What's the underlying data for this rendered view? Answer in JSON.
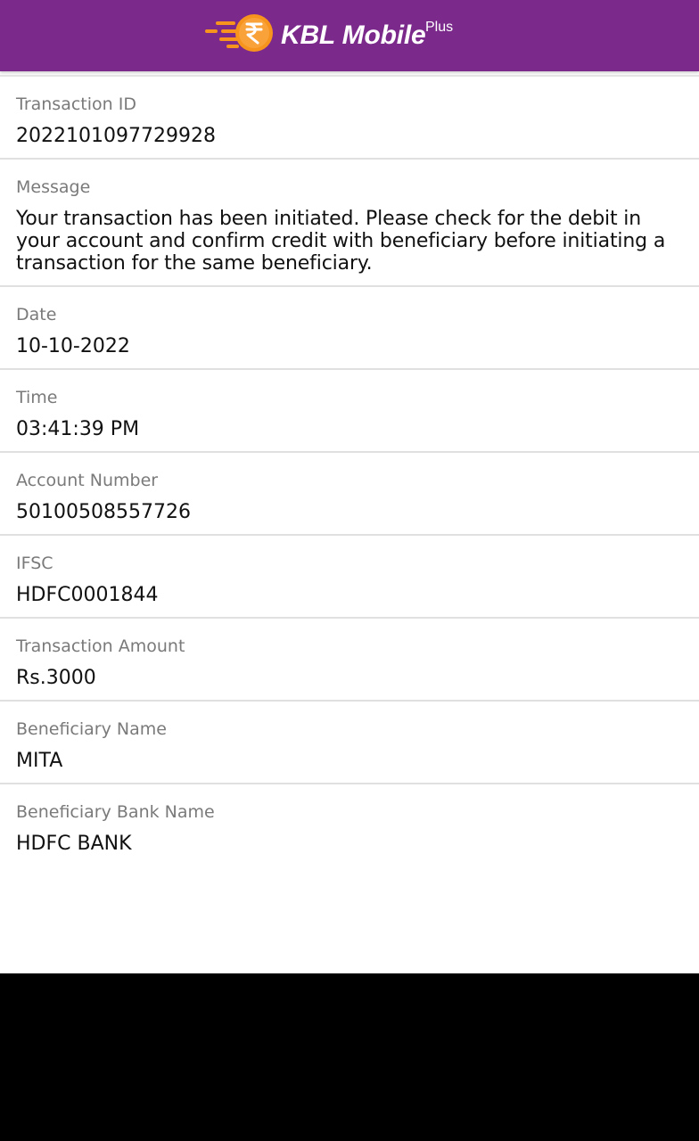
{
  "header": {
    "brand": "KBL Mobile",
    "brand_sup": "Plus",
    "logo_icon": "rupee-coin-icon",
    "logo_color": "#f7941d",
    "background": "#7b2a8c"
  },
  "details": [
    {
      "label": "Transaction ID",
      "value": "2022101097729928"
    },
    {
      "label": "Message",
      "value": "Your transaction has been initiated. Please check for the debit in your account and confirm credit with beneficiary before initiating a transaction for the same beneficiary."
    },
    {
      "label": "Date",
      "value": "10-10-2022"
    },
    {
      "label": "Time",
      "value": "03:41:39 PM"
    },
    {
      "label": "Account Number",
      "value": "50100508557726"
    },
    {
      "label": "IFSC",
      "value": "HDFC0001844"
    },
    {
      "label": "Transaction Amount",
      "value": "Rs.3000"
    },
    {
      "label": "Beneficiary Name",
      "value": "MITA"
    },
    {
      "label": "Beneficiary Bank Name",
      "value": "HDFC BANK"
    }
  ]
}
